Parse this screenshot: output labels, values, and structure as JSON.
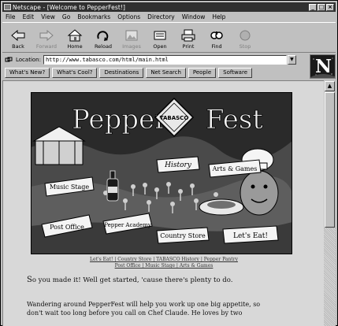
{
  "window": {
    "title": "Netscape - [Welcome to PepperFest!]",
    "controls": [
      "_",
      "□",
      "×"
    ]
  },
  "menu": [
    "File",
    "Edit",
    "View",
    "Go",
    "Bookmarks",
    "Options",
    "Directory",
    "Window",
    "Help"
  ],
  "toolbar": [
    {
      "label": "Back",
      "icon": "back-arrow-icon",
      "enabled": true
    },
    {
      "label": "Forward",
      "icon": "forward-arrow-icon",
      "enabled": false
    },
    {
      "label": "Home",
      "icon": "home-icon",
      "enabled": true
    },
    {
      "label": "Reload",
      "icon": "reload-icon",
      "enabled": true
    },
    {
      "label": "Images",
      "icon": "images-icon",
      "enabled": false
    },
    {
      "label": "Open",
      "icon": "open-icon",
      "enabled": true
    },
    {
      "label": "Print",
      "icon": "print-icon",
      "enabled": true
    },
    {
      "label": "Find",
      "icon": "find-icon",
      "enabled": true
    },
    {
      "label": "Stop",
      "icon": "stop-icon",
      "enabled": false
    }
  ],
  "location": {
    "label": "Location:",
    "url": "http://www.tabasco.com/html/main.html"
  },
  "directory_buttons": [
    "What's New?",
    "What's Cool?",
    "Destinations",
    "Net Search",
    "People",
    "Software"
  ],
  "logo": {
    "letter": "N"
  },
  "content": {
    "imagemap": {
      "title_left": "Pepper",
      "title_right": "Fest",
      "badge": "TABASCO",
      "signs": [
        "History",
        "Arts & Games",
        "Music Stage",
        "Post Office",
        "Pepper Academy",
        "Country Store",
        "Let's Eat!"
      ]
    },
    "nav_links_line1": "Let's Eat! | Country Store | TABASCO History | Pepper Pantry",
    "nav_links_line2": "Post Office | Music Stage | Arts & Games",
    "intro_first_letter": "S",
    "intro_rest": "o you made it! Well get started, 'cause there's plenty to do.",
    "para2_line1": "Wandering around PepperFest will help you work up one big appetite, so",
    "para2_line2": "don't wait too long before you call on Chef Claude. He loves by two"
  },
  "colors": {
    "chrome": "#c0c0c0",
    "titlebar": "#303030",
    "content_bg": "#d8d8d8",
    "logo_bg": "#1a1a1a"
  }
}
